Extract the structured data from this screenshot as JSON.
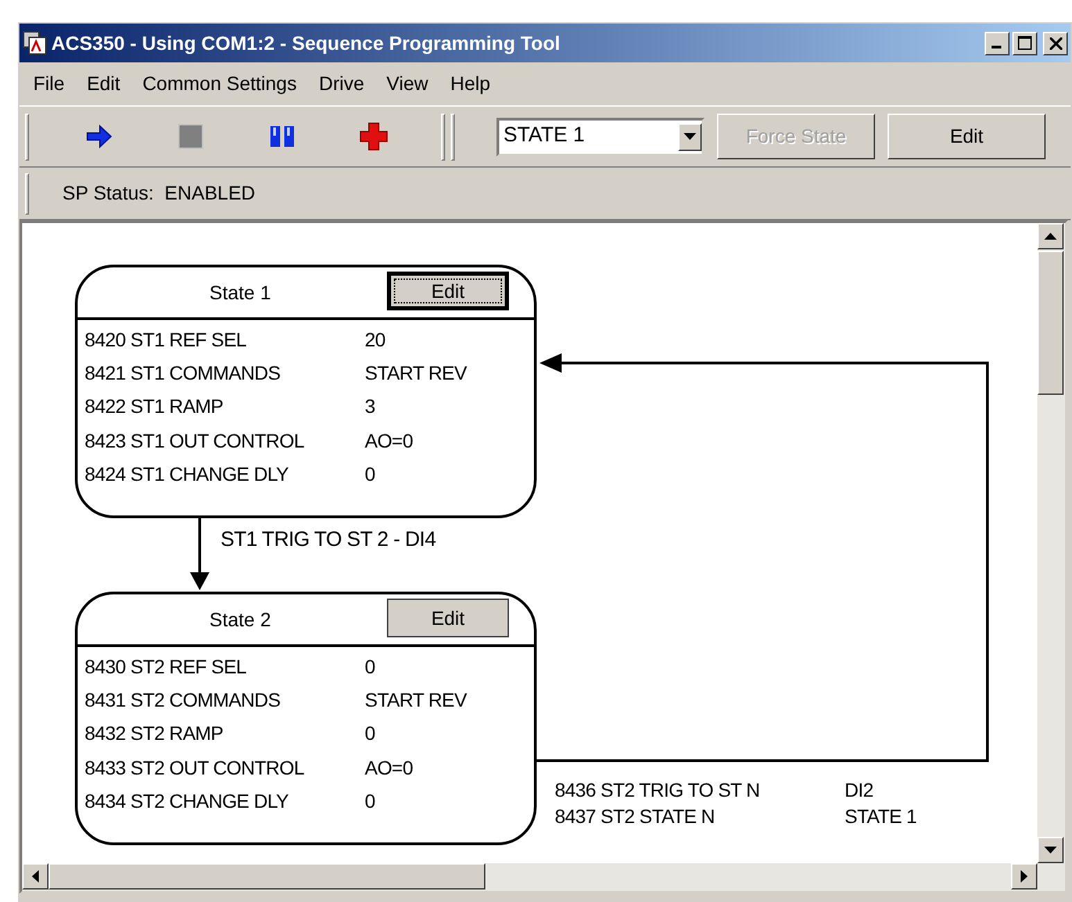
{
  "window": {
    "title": "ACS350 - Using COM1:2 - Sequence Programming Tool"
  },
  "menu": [
    "File",
    "Edit",
    "Common Settings",
    "Drive",
    "View",
    "Help"
  ],
  "toolbar": {
    "buttons": [
      {
        "kind": "run"
      },
      {
        "kind": "stop"
      },
      {
        "kind": "pause"
      },
      {
        "kind": "add"
      }
    ],
    "state_select": {
      "value": "STATE 1"
    },
    "force_state": {
      "label": "Force State",
      "disabled": true
    },
    "edit": {
      "label": "Edit"
    }
  },
  "status": "SP Status:  ENABLED",
  "states": [
    {
      "title": "State 1",
      "edit": {
        "label": "Edit",
        "focused": true
      },
      "params": [
        {
          "name": "8420 ST1 REF SEL",
          "value": "20"
        },
        {
          "name": "8421 ST1 COMMANDS",
          "value": "START REV"
        },
        {
          "name": "8422 ST1 RAMP",
          "value": "3"
        },
        {
          "name": "8423 ST1 OUT CONTROL",
          "value": "AO=0"
        },
        {
          "name": "8424 ST1 CHANGE DLY",
          "value": "0"
        }
      ]
    },
    {
      "title": "State 2",
      "edit": {
        "label": "Edit",
        "focused": false
      },
      "params": [
        {
          "name": "8430 ST2 REF SEL",
          "value": "0"
        },
        {
          "name": "8431 ST2 COMMANDS",
          "value": "START REV"
        },
        {
          "name": "8432 ST2 RAMP",
          "value": "0"
        },
        {
          "name": "8433 ST2 OUT CONTROL",
          "value": "AO=0"
        },
        {
          "name": "8434 ST2 CHANGE DLY",
          "value": "0"
        }
      ]
    }
  ],
  "transition": {
    "label": "ST1 TRIG TO ST 2 - DI4"
  },
  "trigger_params": [
    {
      "name": "8436 ST2 TRIG TO ST N",
      "value": "DI2"
    },
    {
      "name": "8437 ST2 STATE N",
      "value": "STATE 1"
    }
  ]
}
